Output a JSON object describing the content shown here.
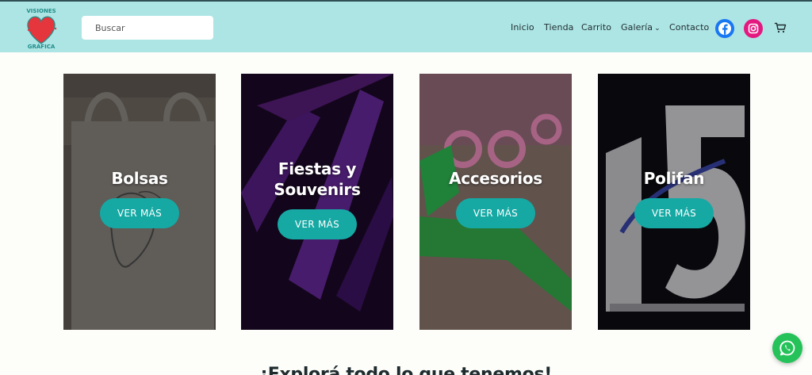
{
  "logo": {
    "text_top": "VISIONES",
    "text_bottom": "GRÁFICA"
  },
  "search": {
    "placeholder": "Buscar"
  },
  "nav": {
    "items": [
      {
        "label": "Inicio"
      },
      {
        "label": "Tienda"
      },
      {
        "label": "Carrito"
      },
      {
        "label": "Galería",
        "has_dropdown": true
      },
      {
        "label": "Contacto"
      }
    ]
  },
  "social": {
    "facebook_icon": "facebook-icon",
    "instagram_icon": "instagram-icon",
    "cart_icon": "cart-icon"
  },
  "cards": [
    {
      "title": "Bolsas",
      "button": "VER MÁS"
    },
    {
      "title": "Fiestas y Souvenirs",
      "button": "VER MÁS"
    },
    {
      "title": "Accesorios",
      "button": "VER MÁS"
    },
    {
      "title": "Polifan",
      "button": "VER MÁS"
    }
  ],
  "explore": {
    "heading": "¡Explorá todo lo que tenemos!"
  },
  "whatsapp": {
    "icon": "whatsapp-icon"
  },
  "colors": {
    "header_bg": "#ade4e4",
    "button": "#16a9a4",
    "facebook": "#1877f2",
    "instagram": "#e3197f",
    "whatsapp": "#25c25a"
  }
}
